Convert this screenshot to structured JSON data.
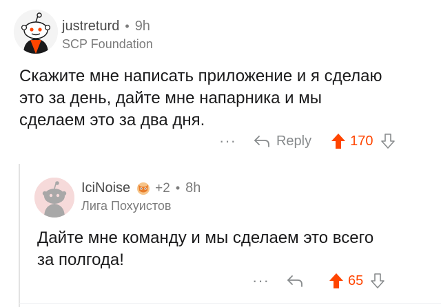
{
  "top_comment": {
    "username": "justreturd",
    "separator": "•",
    "time": "9h",
    "flair": "SCP Foundation",
    "body_lines": [
      "Скажите мне написать приложение и я сделаю",
      "это за день, дайте мне напарника и мы",
      "сделаем это за два дня."
    ],
    "more": "···",
    "reply_label": "Reply",
    "score": "170",
    "avatar_icon": "snoo-avatar-icon"
  },
  "reply_comment": {
    "username": "IciNoise",
    "award_icon": "award-icon",
    "awards": "+2",
    "separator": "•",
    "time": "8h",
    "flair": "Лига Похуистов",
    "body_lines": [
      "Дайте мне команду и мы сделаем это всего",
      "за полгода!"
    ],
    "more": "···",
    "score": "65",
    "avatar_icon": "snoo-avatar-icon"
  },
  "colors": {
    "upvote": "#ff4500",
    "muted": "#878a8c",
    "text": "#1a1a1b"
  }
}
